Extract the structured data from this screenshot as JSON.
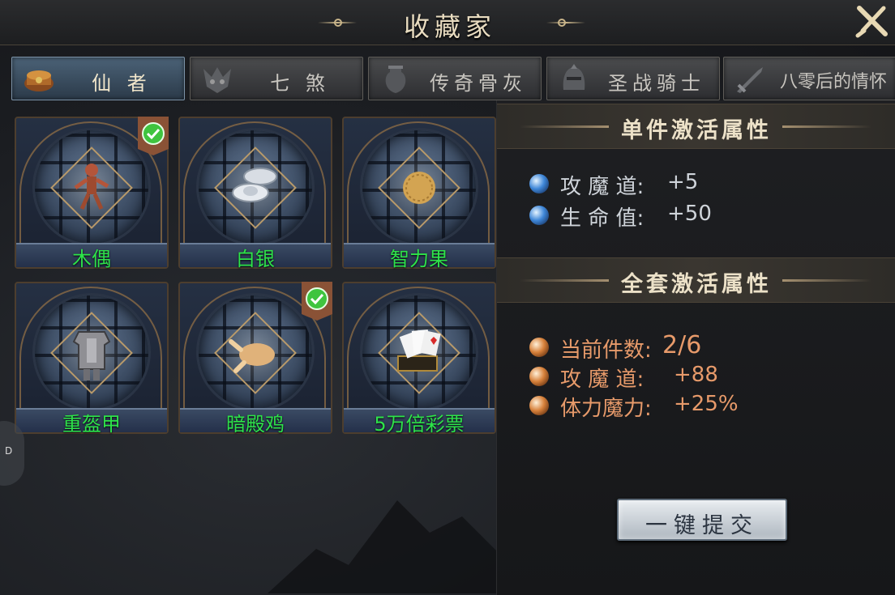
{
  "window": {
    "title": "收藏家"
  },
  "tabs": [
    {
      "label": "仙  者",
      "active": true,
      "icon": "treasure-chest-icon"
    },
    {
      "label": "七  煞",
      "active": false,
      "icon": "demon-mask-icon"
    },
    {
      "label": "传奇骨灰",
      "active": false,
      "icon": "urn-icon"
    },
    {
      "label": "圣战骑士",
      "active": false,
      "icon": "knight-helmet-icon"
    },
    {
      "label": "八零后的情怀",
      "active": false,
      "icon": "sword-icon"
    }
  ],
  "items": [
    {
      "name": "木偶",
      "icon": "puppet-icon",
      "collected": true
    },
    {
      "name": "白银",
      "icon": "silver-ingot-icon",
      "collected": false
    },
    {
      "name": "智力果",
      "icon": "fruit-icon",
      "collected": false
    },
    {
      "name": "重盔甲",
      "icon": "armor-icon",
      "collected": false
    },
    {
      "name": "暗殿鸡",
      "icon": "roast-chicken-icon",
      "collected": true
    },
    {
      "name": "5万倍彩票",
      "icon": "lottery-cards-icon",
      "collected": false
    }
  ],
  "single_set": {
    "title": "单件激活属性",
    "attributes": [
      {
        "label": "攻 魔 道:",
        "value": "+5"
      },
      {
        "label": "生 命 值:",
        "value": "+50"
      }
    ]
  },
  "full_set": {
    "title": "全套激活属性",
    "count_label": "当前件数:",
    "count_value": "2/6",
    "attributes": [
      {
        "label": "攻 魔 道:",
        "value": "+88"
      },
      {
        "label": "体力魔力:",
        "value": "+25%"
      }
    ]
  },
  "submit_label": "一键提交",
  "side_handle_label": "D",
  "colors": {
    "item_name": "#2ee34a",
    "blue_attr": "#cfd4da",
    "orange_attr": "#e79a6a"
  }
}
